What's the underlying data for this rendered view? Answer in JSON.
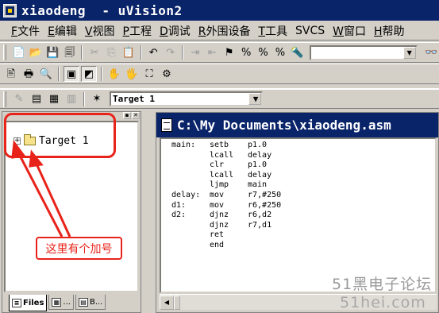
{
  "window": {
    "title": "xiaodeng  - uVision2"
  },
  "menu": [
    {
      "acc": "F",
      "label": "文件"
    },
    {
      "acc": "E",
      "label": "编辑"
    },
    {
      "acc": "V",
      "label": "视图"
    },
    {
      "acc": "P",
      "label": "工程"
    },
    {
      "acc": "D",
      "label": "调试"
    },
    {
      "acc": "R",
      "label": "外围设备"
    },
    {
      "acc": "T",
      "label": "工具"
    },
    {
      "acc": "",
      "label": "SVCS"
    },
    {
      "acc": "W",
      "label": "窗口"
    },
    {
      "acc": "H",
      "label": "帮助"
    }
  ],
  "build_toolbar": {
    "target_select": "Target 1"
  },
  "project_pane": {
    "tree_root": "Target 1",
    "tabs": [
      "Files",
      "...",
      "B..."
    ]
  },
  "editor": {
    "title": "C:\\My Documents\\xiaodeng.asm",
    "lines": [
      {
        "label": "main:",
        "op": "setb",
        "args": "p1.0"
      },
      {
        "label": "",
        "op": "lcall",
        "args": "delay"
      },
      {
        "label": "",
        "op": "clr",
        "args": "p1.0"
      },
      {
        "label": "",
        "op": "lcall",
        "args": "delay"
      },
      {
        "label": "",
        "op": "ljmp",
        "args": "main"
      },
      {
        "label": "delay:",
        "op": "mov",
        "args": "r7,#250"
      },
      {
        "label": "d1:",
        "op": "mov",
        "args": "r6,#250"
      },
      {
        "label": "d2:",
        "op": "djnz",
        "args": "r6,d2"
      },
      {
        "label": "",
        "op": "djnz",
        "args": "r7,d1"
      },
      {
        "label": "",
        "op": "ret",
        "args": ""
      },
      {
        "label": "",
        "op": "end",
        "args": ""
      }
    ]
  },
  "annotation": {
    "text": "这里有个加号",
    "color": "#e8231a"
  },
  "watermark": {
    "line1": "51黑电子论坛",
    "line2": "51hei.com"
  },
  "colors": {
    "titlebar": "#0a246a",
    "face": "#d4d0c8"
  }
}
